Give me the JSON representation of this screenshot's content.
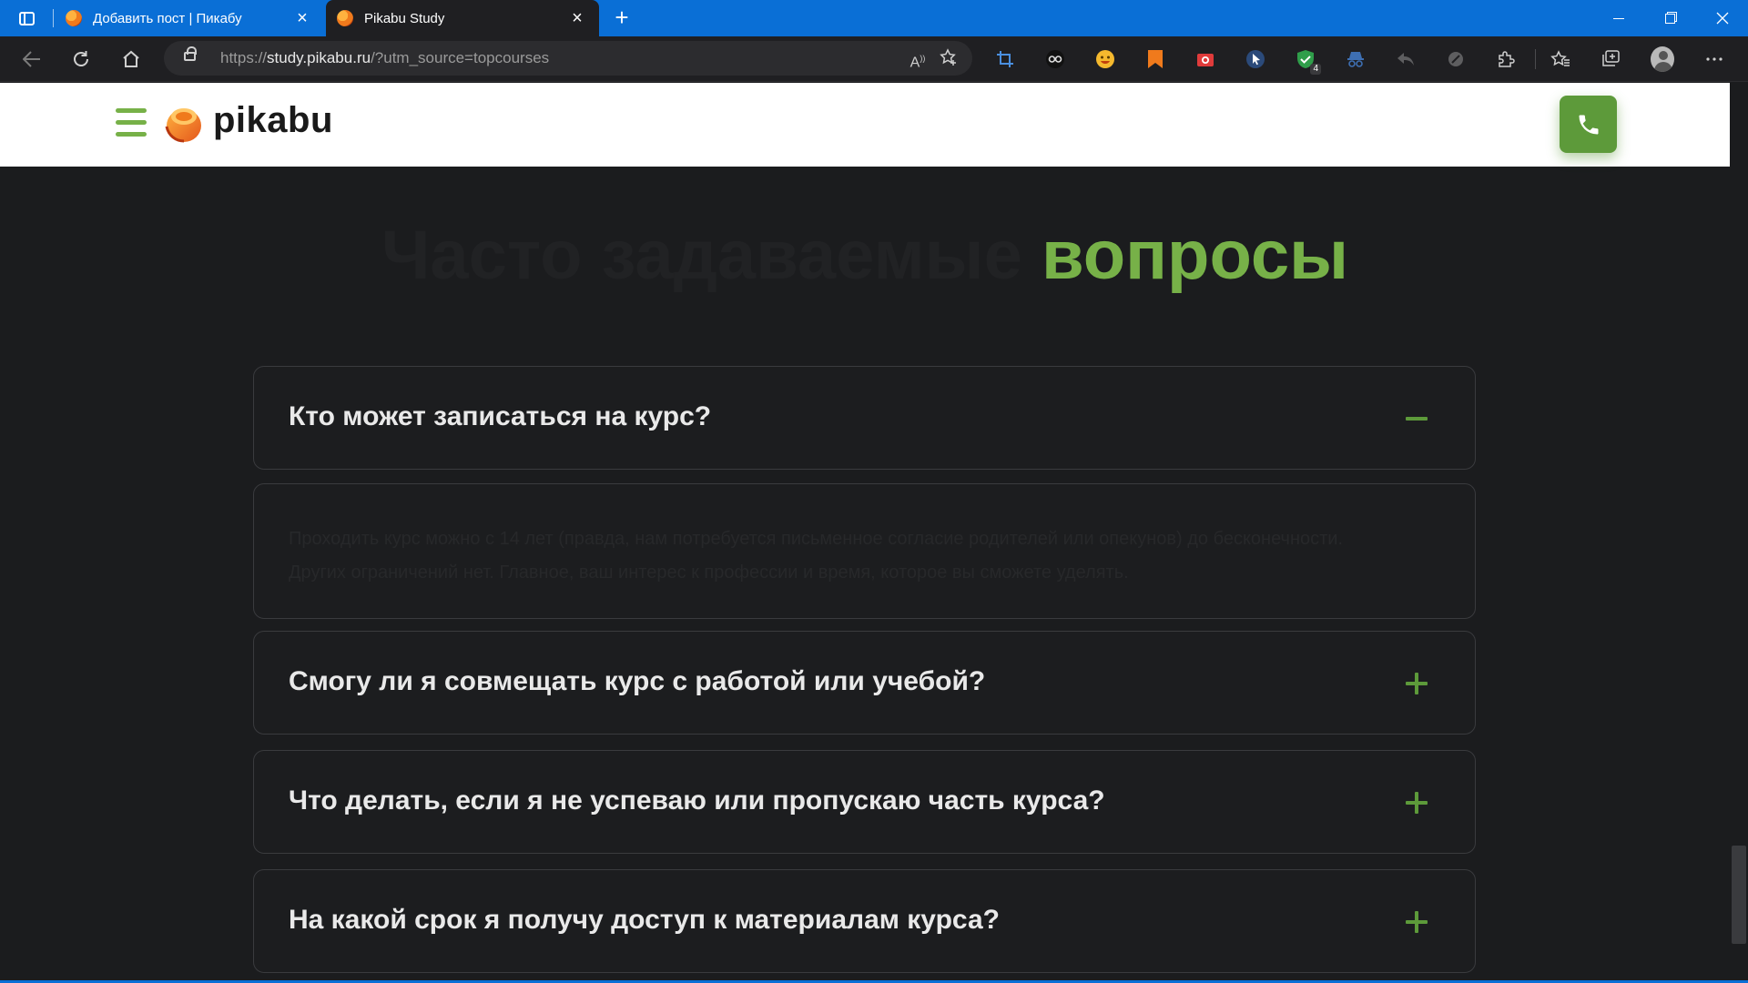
{
  "browser": {
    "tabs": [
      {
        "title": "Добавить пост | Пикабу",
        "active": false
      },
      {
        "title": "Pikabu Study",
        "active": true
      }
    ],
    "new_tab_label": "+",
    "close_glyph": "×",
    "url_prefix": "https://",
    "url_host": "study.pikabu.ru",
    "url_rest": "/?utm_source=topcourses",
    "extension_badge": "4"
  },
  "site": {
    "logo_text": "pikabu",
    "brand_color": "#77b148",
    "accent_dark": "#5d9a3a"
  },
  "faq": {
    "title_part1": "Часто задаваемые",
    "title_part2": "вопросы",
    "items": [
      {
        "question": "Кто может записаться на курс?",
        "expanded": true,
        "answer": "Проходить курс можно с 14 лет (правда, нам потребуется письменное согласие родителей или опекунов) до бесконечности. Других ограничений нет. Главное, ваш интерес к профессии и время, которое вы сможете уделять."
      },
      {
        "question": "Смогу ли я совмещать курс с работой или учебой?",
        "expanded": false
      },
      {
        "question": "Что делать, если я не успеваю или пропускаю часть курса?",
        "expanded": false
      },
      {
        "question": "На какой срок я получу доступ к материалам курса?",
        "expanded": false
      }
    ]
  }
}
